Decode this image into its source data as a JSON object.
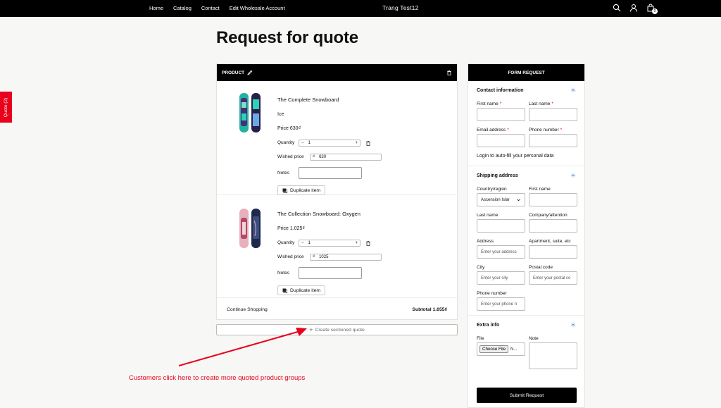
{
  "header": {
    "nav": [
      "Home",
      "Catalog",
      "Contact",
      "Edit Wholesale Account"
    ],
    "brand": "Trang Test12",
    "cart_count": "0"
  },
  "side_tab": {
    "label": "Quote (2)"
  },
  "page": {
    "title": "Request for quote"
  },
  "products_panel": {
    "header": "PRODUCT",
    "labels": {
      "quantity": "Quantity",
      "wished_price": "Wished price",
      "notes": "Notes",
      "duplicate": "Duplicate item",
      "currency": "₫",
      "minus": "−",
      "plus": "+"
    },
    "items": [
      {
        "name": "The Complete Snowboard",
        "variant": "Ice",
        "price": "Price  630₫",
        "quantity": "1",
        "wished_price": "630"
      },
      {
        "name": "The Collection Snowboard: Oxygen",
        "price": "Price  1.025₫",
        "quantity": "1",
        "wished_price": "1025"
      }
    ],
    "footer": {
      "continue": "Continue Shopping",
      "subtotal": "Subtotal 1.655₫"
    }
  },
  "create_quote": {
    "label": "Create sectioned quote",
    "plus": "+"
  },
  "annotation": "Customers click here to create more quoted product groups",
  "colors": {
    "accent": "#e8001c",
    "header": "#000000"
  },
  "form": {
    "header": "FORM REQUEST",
    "contact": {
      "title": "Contact information",
      "first_name": "First name",
      "last_name": "Last name",
      "email": "Email address",
      "phone": "Phone number",
      "required_mark": "*",
      "login_text": "Login to auto-fill your personal data"
    },
    "shipping": {
      "title": "Shipping address",
      "country_label": "Country/region",
      "country_value": "Ascension Islar",
      "first_name": "First name",
      "last_name": "Last name",
      "company": "Company/attention",
      "address": "Address",
      "address_ph": "Enter your address",
      "apartment": "Apartment, suite, etc",
      "city": "City",
      "city_ph": "Enter your city",
      "postal": "Postal code",
      "postal_ph": "Enter your postal co",
      "phone": "Phone number",
      "phone_ph": "Enter your phone n"
    },
    "extra": {
      "title": "Extra info",
      "file": "File",
      "file_button": "Choose File",
      "file_status": "N...",
      "note": "Note"
    },
    "submit": "Submit Request"
  }
}
